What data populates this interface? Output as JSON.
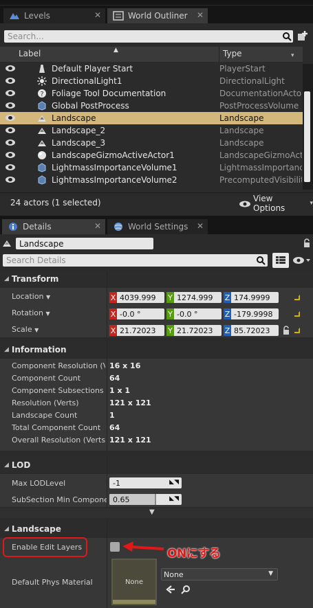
{
  "top_tabs": [
    {
      "label": "Levels",
      "icon": "levels-icon"
    },
    {
      "label": "World Outliner",
      "icon": "outliner-icon"
    }
  ],
  "outliner": {
    "search_placeholder": "Search...",
    "col_label": "Label",
    "col_type": "Type",
    "rows": [
      {
        "name": "Default Player Start",
        "type": "PlayerStart",
        "icon": "player-start-icon"
      },
      {
        "name": "DirectionalLight1",
        "type": "DirectionalLight",
        "icon": "sun-icon"
      },
      {
        "name": "Foliage Tool Documentation",
        "type": "DocumentationActor",
        "icon": "documentation-icon"
      },
      {
        "name": "Global PostProcess",
        "type": "PostProcessVolume",
        "icon": "volume-icon"
      },
      {
        "name": "Landscape",
        "type": "Landscape",
        "icon": "landscape-icon",
        "selected": true
      },
      {
        "name": "Landscape_2",
        "type": "Landscape",
        "icon": "landscape-icon"
      },
      {
        "name": "Landscape_3",
        "type": "Landscape",
        "icon": "landscape-icon"
      },
      {
        "name": "LandscapeGizmoActiveActor1",
        "type": "LandscapeGizmoActiv",
        "icon": "sphere-icon"
      },
      {
        "name": "LightmassImportanceVolume1",
        "type": "LightmassImportance",
        "icon": "volume-icon"
      },
      {
        "name": "LightmassImportanceVolume2",
        "type": "PrecomputedVisibility",
        "icon": "volume-icon"
      }
    ],
    "actor_count": "24 actors (1 selected)",
    "view_options": "View Options"
  },
  "bottom_tabs": [
    {
      "label": "Details",
      "icon": "details-icon"
    },
    {
      "label": "World Settings",
      "icon": "world-icon"
    }
  ],
  "details": {
    "actor_name": "Landscape",
    "search_placeholder": "Search Details",
    "transform": {
      "title": "Transform",
      "location_label": "Location",
      "rotation_label": "Rotation",
      "scale_label": "Scale",
      "location": [
        "4039.999",
        "1274.999",
        "174.9999"
      ],
      "rotation": [
        "-0.0 °",
        "-0.0 °",
        "-179.9998"
      ],
      "scale": [
        "21.72023",
        "21.72023",
        "85.72023"
      ],
      "axis_x": "X",
      "axis_y": "Y",
      "axis_z": "Z"
    },
    "information": {
      "title": "Information",
      "rows": [
        {
          "label": "Component Resolution (Ver",
          "value": "16 x 16"
        },
        {
          "label": "Component Count",
          "value": "64"
        },
        {
          "label": "Component Subsections",
          "value": "1 x 1"
        },
        {
          "label": "Resolution (Verts)",
          "value": "121 x 121"
        },
        {
          "label": "Landscape Count",
          "value": "1"
        },
        {
          "label": "Total Component Count",
          "value": "64"
        },
        {
          "label": "Overall Resolution (Verts)",
          "value": "121 x 121"
        }
      ]
    },
    "lod": {
      "title": "LOD",
      "max_lod_label": "Max LODLevel",
      "max_lod_value": "-1",
      "subsection_label": "SubSection Min Component",
      "subsection_value": "0.65",
      "subsection_fraction": 0.65
    },
    "landscape": {
      "title": "Landscape",
      "enable_edit_layers_label": "Enable Edit Layers",
      "enable_edit_layers_checked": false,
      "annotation": "ONにする",
      "default_phys_label": "Default Phys Material",
      "thumbnail_label": "None",
      "dropdown_value": "None"
    }
  },
  "colors": {
    "selected_row": "#d3b77b",
    "annotation_red": "#e01818",
    "axis_x": "#c2261e",
    "axis_y": "#5a9b16",
    "axis_z": "#1f5fb8"
  }
}
